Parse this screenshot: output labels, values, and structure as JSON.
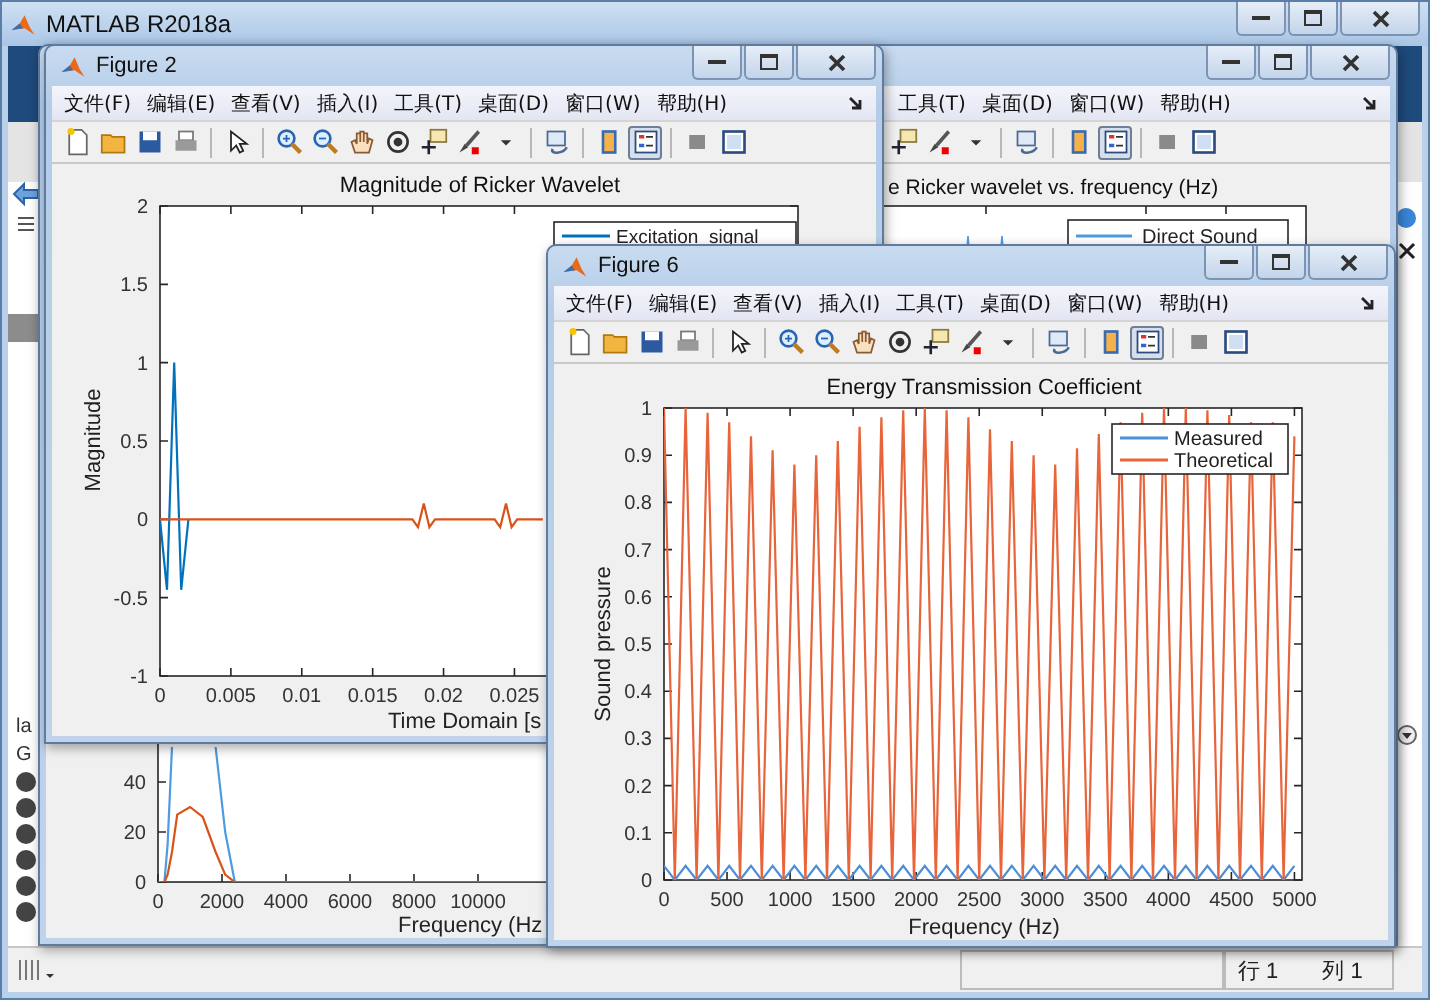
{
  "main_window": {
    "title": "MATLAB R2018a",
    "side_texts": [
      "la",
      "G"
    ]
  },
  "back_figure": {
    "menu": [
      "工具(T)",
      "桌面(D)",
      "窗口(W)",
      "帮助(H)"
    ],
    "toolbar": {
      "legend_pressed": true
    },
    "top_plot": {
      "title": "e Ricker wavelet vs. frequency (Hz)",
      "legend": [
        "Direct Sound"
      ]
    },
    "bottom_plot": {
      "chart_data": {
        "type": "line",
        "xlabel": "Frequency (Hz",
        "x": [
          0,
          200,
          300,
          440,
          600,
          1000,
          1400,
          1800,
          2100,
          2400,
          16000
        ],
        "series": [
          {
            "color": "#4d9be0",
            "values": [
              0,
              0,
              15,
              54,
              null,
              null,
              null,
              54,
              20,
              0,
              null
            ]
          },
          {
            "color": "#d95319",
            "values": [
              0,
              0,
              3,
              12,
              27,
              30,
              26,
              12,
              3,
              0,
              0
            ]
          }
        ],
        "xlim": [
          0,
          16000
        ],
        "ylim": [
          0,
          80
        ],
        "xticks": [
          0,
          2000,
          4000,
          6000,
          8000,
          10000
        ],
        "yticks": [
          0,
          20,
          40
        ]
      }
    }
  },
  "figure_2": {
    "title": "Figure 2",
    "menu": [
      "文件(F)",
      "编辑(E)",
      "查看(V)",
      "插入(I)",
      "工具(T)",
      "桌面(D)",
      "窗口(W)",
      "帮助(H)"
    ],
    "toolbar": {
      "legend_pressed": true
    },
    "plot": {
      "chart_data": {
        "type": "line",
        "title": "Magnitude of Ricker Wavelet",
        "xlabel": "Time Domain [s",
        "ylabel": "Magnitude",
        "x": [
          0,
          0.0005,
          0.001,
          0.0015,
          0.002,
          0.0178,
          0.0182,
          0.0186,
          0.019,
          0.0194,
          0.0236,
          0.024,
          0.0244,
          0.0248,
          0.0252,
          0.027
        ],
        "series": [
          {
            "name": "Excitation  signal",
            "color": "#0072bd",
            "values": [
              0,
              -0.45,
              1,
              -0.45,
              0,
              null,
              null,
              null,
              null,
              null,
              null,
              null,
              null,
              null,
              null,
              null
            ]
          },
          {
            "color": "#d95319",
            "values": [
              0,
              0,
              0,
              0,
              0,
              0,
              -0.05,
              0.1,
              -0.05,
              0,
              0,
              -0.05,
              0.1,
              -0.05,
              0,
              0
            ]
          }
        ],
        "legend": "upper right",
        "xlim": [
          0,
          0.045
        ],
        "ylim": [
          -1,
          2
        ],
        "xticks": [
          0,
          0.005,
          0.01,
          0.015,
          0.02,
          0.025
        ],
        "yticks": [
          -1,
          -0.5,
          0,
          0.5,
          1,
          1.5,
          2
        ]
      }
    }
  },
  "figure_6": {
    "title": "Figure 6",
    "menu": [
      "文件(F)",
      "编辑(E)",
      "查看(V)",
      "插入(I)",
      "工具(T)",
      "桌面(D)",
      "窗口(W)",
      "帮助(H)"
    ],
    "toolbar": {
      "legend_pressed": true
    },
    "plot": {
      "chart_data": {
        "type": "line",
        "title": "Energy Transmission Coefficient",
        "xlabel": "Frequency (Hz)",
        "ylabel": "Sound pressure",
        "x": [
          0,
          86,
          172,
          259,
          345,
          431,
          517,
          603,
          690,
          776,
          862,
          948,
          1034,
          1121,
          1207,
          1293,
          1379,
          1466,
          1552,
          1638,
          1724,
          1810,
          1897,
          1983,
          2069,
          2155,
          2241,
          2328,
          2414,
          2500,
          2586,
          2672,
          2759,
          2845,
          2931,
          3017,
          3103,
          3190,
          3276,
          3362,
          3448,
          3534,
          3621,
          3707,
          3793,
          3879,
          3966,
          4052,
          4138,
          4224,
          4310,
          4397,
          4483,
          4569,
          4655,
          4741,
          4828,
          4914,
          5000
        ],
        "series": [
          {
            "name": "Measured",
            "color": "#4d8fd6",
            "values": [
              0.03,
              0,
              0.03,
              0,
              0.03,
              0,
              0.03,
              0,
              0.03,
              0,
              0.03,
              0,
              0.03,
              0,
              0.03,
              0,
              0.03,
              0,
              0.03,
              0,
              0.03,
              0,
              0.03,
              0,
              0.03,
              0,
              0.03,
              0,
              0.03,
              0,
              0.03,
              0,
              0.03,
              0,
              0.03,
              0,
              0.03,
              0,
              0.03,
              0,
              0.03,
              0,
              0.03,
              0,
              0.03,
              0,
              0.03,
              0,
              0.03,
              0,
              0.03,
              0,
              0.03,
              0,
              0.03,
              0,
              0.03,
              0,
              0.03
            ]
          },
          {
            "name": "Theoretical",
            "color": "#e8643a",
            "values": [
              1,
              0,
              1,
              0,
              0.99,
              0,
              0.97,
              0,
              0.94,
              0,
              0.91,
              0,
              0.88,
              0,
              0.9,
              0,
              0.93,
              0,
              0.96,
              0,
              0.98,
              0,
              0.995,
              0,
              1,
              0,
              0.995,
              0,
              0.98,
              0,
              0.955,
              0,
              0.93,
              0,
              0.9,
              0,
              0.88,
              0,
              0.915,
              0,
              0.945,
              0,
              0.97,
              0,
              0.99,
              0,
              1,
              0,
              1,
              0,
              0.995,
              0,
              0.985,
              0,
              0.97,
              0,
              0.97,
              0,
              0.94
            ]
          }
        ],
        "legend": "upper right",
        "xlim": [
          0,
          5060
        ],
        "ylim": [
          0,
          1
        ],
        "xticks": [
          0,
          500,
          1000,
          1500,
          2000,
          2500,
          3000,
          3500,
          4000,
          4500,
          5000
        ],
        "yticks": [
          0,
          0.1,
          0.2,
          0.3,
          0.4,
          0.5,
          0.6,
          0.7,
          0.8,
          0.9,
          1
        ]
      }
    }
  },
  "status_bar": {
    "fields": [
      "行 1",
      "列 1"
    ]
  }
}
